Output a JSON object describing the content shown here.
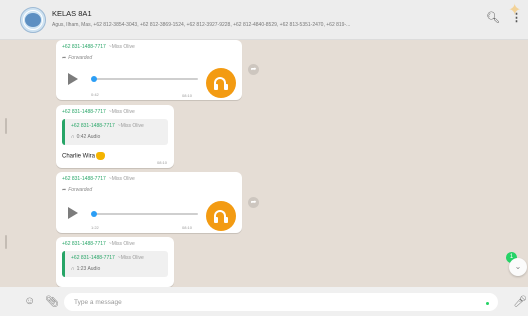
{
  "header": {
    "group_name": "KELAS 8A1",
    "members": "Agus, Ilham, Mas, +62 812-3854-3043, +62 812-3869-1524, +62 812-3927-9228, +62 812-4840-8529, +62 813-5351-2470, +62 819-...",
    "search_icon": "search-icon",
    "menu_icon": "more-vertical-icon"
  },
  "messages": [
    {
      "type": "audio",
      "sender_phone": "+62 831-1488-7717",
      "sender_name": "~Miss Olive",
      "forwarded_label": "Forwarded",
      "duration": "0:42",
      "time": "08:10",
      "progress": 0.0
    },
    {
      "type": "reply",
      "sender_phone": "+62 831-1488-7717",
      "sender_name": "~Miss Olive",
      "quote_phone": "+62 831-1488-7717",
      "quote_name": "~Miss Olive",
      "quote_text": "0:42 Audio",
      "text": "Charlie Wira",
      "time": "08:10"
    },
    {
      "type": "audio",
      "sender_phone": "+62 831-1488-7717",
      "sender_name": "~Miss Olive",
      "forwarded_label": "Forwarded",
      "duration": "1:22",
      "time": "08:10",
      "progress": 0.0
    },
    {
      "type": "reply",
      "sender_phone": "+62 831-1488-7717",
      "sender_name": "~Miss Olive",
      "quote_phone": "+62 831-1488-7717",
      "quote_name": "~Miss Olive",
      "quote_text": "1:23 Audio"
    }
  ],
  "unread_badge": "1",
  "composer": {
    "placeholder": "Type a message"
  },
  "colors": {
    "accent_green": "#27a567",
    "headphone_orange": "#f39b12",
    "progress_blue": "#2c9ef5",
    "chat_background": "#e5ddd5"
  }
}
